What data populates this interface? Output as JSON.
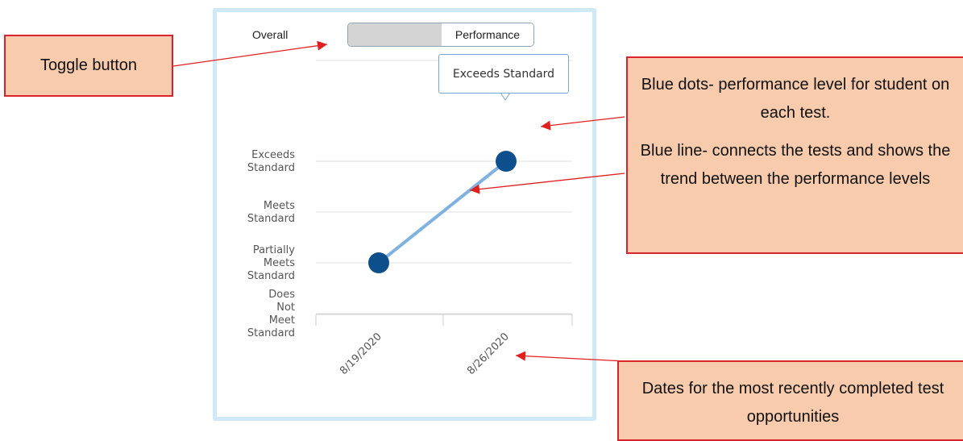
{
  "toggle": {
    "left_label": "Overall",
    "right_label": "Performance"
  },
  "chart_data": {
    "type": "line",
    "categories": [
      "8/19/2020",
      "8/26/2020"
    ],
    "levels": [
      [
        "Does",
        "Not",
        "Meet",
        "Standard"
      ],
      [
        "Partially",
        "Meets",
        "Standard"
      ],
      [
        "Meets",
        "Standard"
      ],
      [
        "Exceeds",
        "Standard"
      ]
    ],
    "series": [
      {
        "values": [
          2,
          4
        ],
        "color": "#0d4f8b",
        "line_color": "#7fb2e0"
      }
    ],
    "tooltip": "Exceeds Standard",
    "grid": true,
    "ylim": [
      0,
      5
    ]
  },
  "callouts": {
    "toggle": "Toggle button",
    "dots": "Blue dots- performance level for student on each test.",
    "line": "Blue line- connects the tests and shows the trend between the performance levels",
    "dates": "Dates for the most recently completed test opportunities"
  },
  "colors": {
    "panel_border": "#cfeaf6",
    "callout_fill": "#f8cbad",
    "callout_border": "#d8242c",
    "arrow": "#e0201f"
  }
}
